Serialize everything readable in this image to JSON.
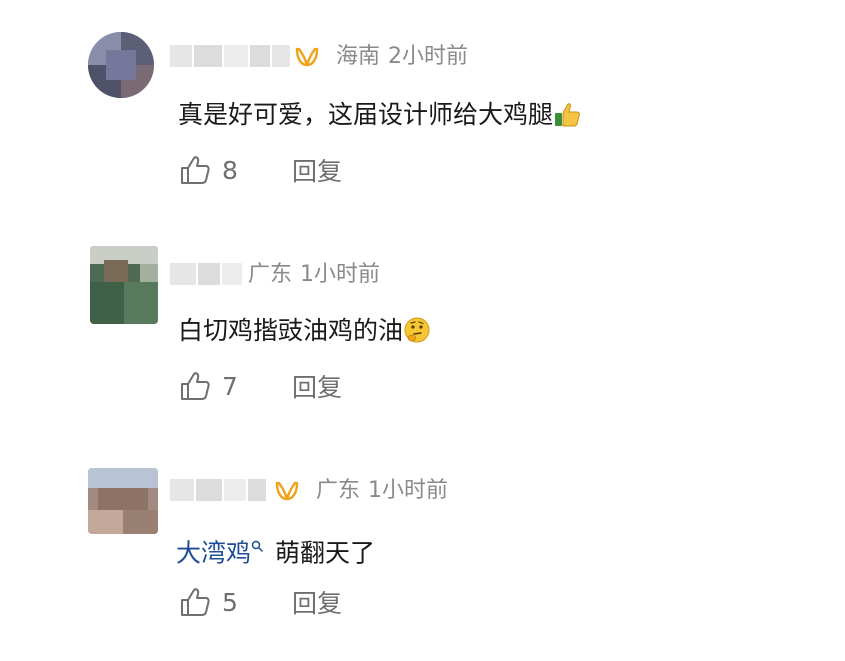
{
  "comments": [
    {
      "location": "海南",
      "time": "2小时前",
      "text": "真是好可爱，这届设计师给大鸡腿",
      "emoji": "thumbs-up-emoji",
      "likes": "8",
      "reply_label": "回复"
    },
    {
      "location": "广东",
      "time": "1小时前",
      "text": "白切鸡揩豉油鸡的油",
      "emoji": "thinking-face-emoji",
      "likes": "7",
      "reply_label": "回复"
    },
    {
      "location": "广东",
      "time": "1小时前",
      "link_text": "大湾鸡",
      "text": "萌翻天了",
      "likes": "5",
      "reply_label": "回复"
    }
  ],
  "colors": {
    "meta": "#8a8a8a",
    "link": "#1f4e96",
    "action": "#6f6f6f",
    "badge": "#f0a21a"
  }
}
